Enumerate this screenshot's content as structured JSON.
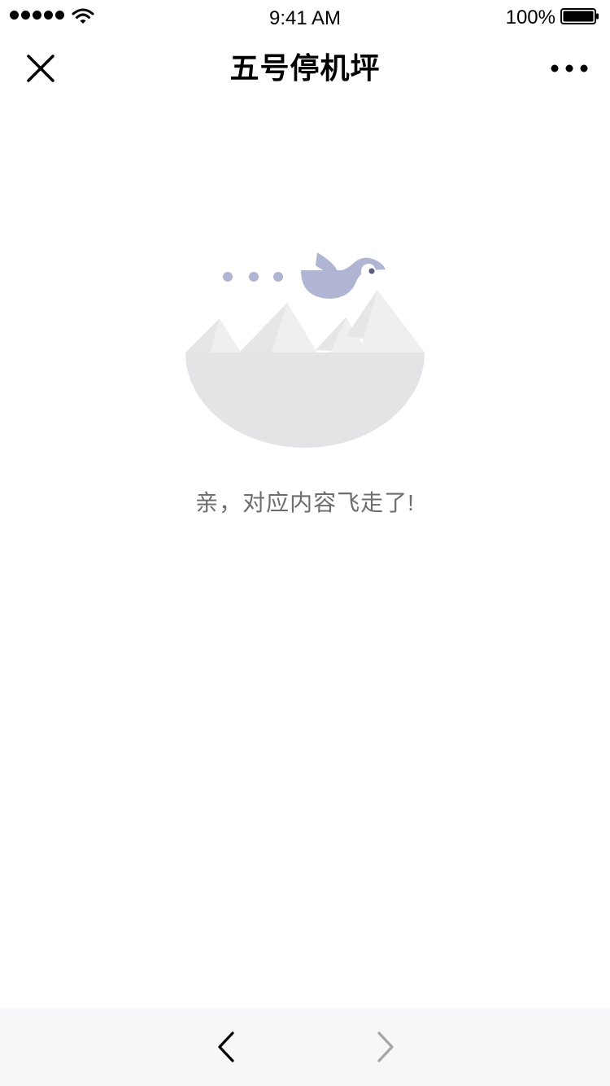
{
  "status_bar": {
    "time": "9:41 AM",
    "battery": "100%",
    "signal_icon": "signal-dots-icon",
    "wifi_icon": "wifi-icon",
    "battery_icon": "battery-icon"
  },
  "nav": {
    "title": "五号停机坪",
    "close_icon": "close-icon",
    "more_icon": "more-icon"
  },
  "empty_state": {
    "message": "亲，对应内容飞走了!",
    "illustration": "bird-mountains-illustration"
  },
  "toolbar": {
    "back_icon": "chevron-left-icon",
    "forward_icon": "chevron-right-icon",
    "forward_enabled": false
  },
  "colors": {
    "bird": "#b0b5d3",
    "mountain_light": "#efefef",
    "mountain_mid": "#e6e6e7",
    "ground": "#e4e4e6",
    "message": "#6d6d6d",
    "toolbar_bg": "#f7f7f9",
    "disabled_icon": "#a5a5a5"
  }
}
